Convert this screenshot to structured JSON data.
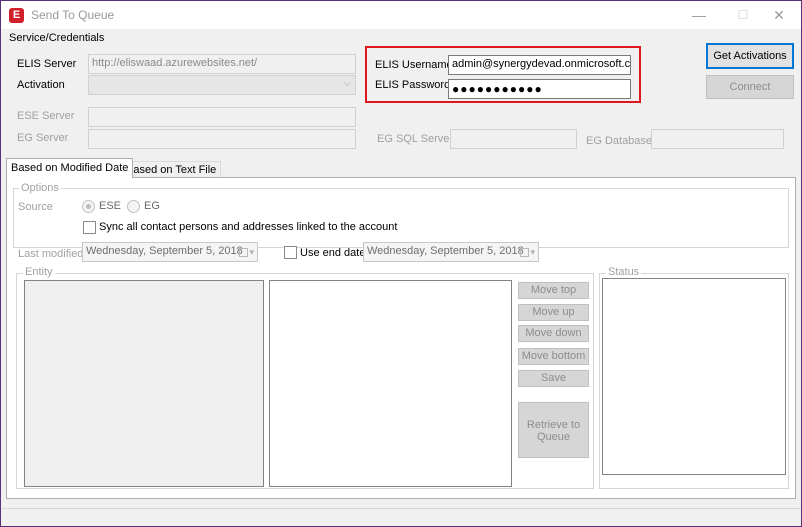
{
  "window": {
    "title": "Send To Queue",
    "icon": "E",
    "minimize_glyph": "—",
    "maximize_glyph": "☐",
    "close_glyph": "✕"
  },
  "credentials": {
    "group_title": "Service/Credentials",
    "elis_server_label": "ELIS Server",
    "elis_server_value": "http://eliswaad.azurewebsites.net/",
    "activation_label": "Activation",
    "activation_value": "",
    "ese_server_label": "ESE Server",
    "eg_server_label": "EG Server",
    "elis_username_label": "ELIS Username",
    "elis_username_value": "admin@synergydevad.onmicrosoft.com",
    "elis_password_label": "ELIS Password",
    "elis_password_value": "●●●●●●●●●●●",
    "eg_sql_server_label": "EG SQL Server",
    "eg_database_label": "EG Database",
    "get_activations_label": "Get Activations",
    "connect_label": "Connect",
    "highlight_color": "#e0161e"
  },
  "tabs": [
    {
      "label": "Based on Modified Date",
      "active": true
    },
    {
      "label": "Based on Text File",
      "active": false
    }
  ],
  "options": {
    "group_title": "Options",
    "source_label": "Source",
    "source_options": [
      "ESE",
      "EG"
    ],
    "source_selected": "ESE",
    "sync_label": "Sync all contact persons and addresses linked to the account",
    "last_modified_label": "Last modified",
    "last_modified_value": "Wednesday, September  5, 2018",
    "use_end_date_label": "Use end date",
    "end_date_value": "Wednesday, September  5, 2018"
  },
  "entity": {
    "group_title": "Entity",
    "buttons": {
      "move_top": "Move top",
      "move_up": "Move up",
      "move_down": "Move down",
      "move_bottom": "Move bottom",
      "save": "Save",
      "retrieve_line1": "Retrieve to",
      "retrieve_line2": "Queue"
    }
  },
  "status": {
    "group_title": "Status"
  }
}
